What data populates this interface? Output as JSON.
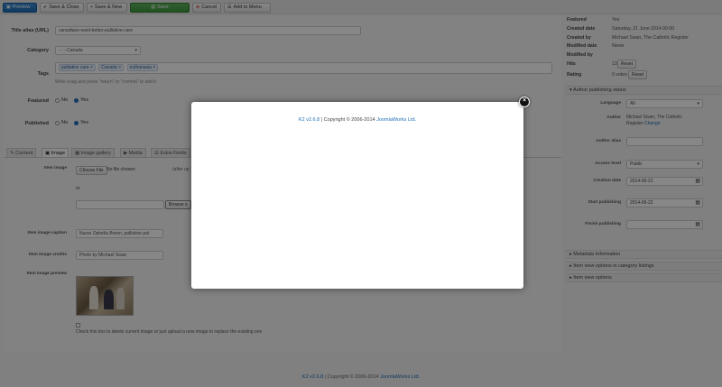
{
  "toolbar": {
    "preview": "Preview",
    "save_close": "Save & Close",
    "save_new": "Save & New",
    "save": "Save",
    "cancel": "Cancel",
    "add_menu": "Add to Menu"
  },
  "form": {
    "title_alias_label": "Title alias (URL)",
    "title_alias_value": "canadians-want-better-palliative-care",
    "category_label": "Category",
    "category_value": "- - - Canada",
    "tags_label": "Tags",
    "tags": [
      "palliative care",
      "Canada",
      "euthanasia"
    ],
    "tags_hint": "Write a tag and press \"return\" or \"comma\" to add it",
    "featured_label": "Featured",
    "published_label": "Published",
    "no": "No",
    "yes": "Yes"
  },
  "tabs": [
    "Content",
    "Image",
    "Image gallery",
    "Media",
    "Extra Fields"
  ],
  "image": {
    "item_image_label": "Item image",
    "choose_file": "Choose File",
    "no_file": "No file chosen",
    "after_upload": "(after up",
    "or": "or",
    "browse": "Browse s",
    "caption_label": "Item image caption",
    "caption_value": "Nurse Ophelia Breen, palliative pal",
    "credits_label": "Item image credits",
    "credits_value": "Photo by Michael Swan",
    "preview_label": "Item image preview",
    "delete_text": "Check this box to delete current image or just upload a new image to replace the existing one"
  },
  "sidebar": {
    "meta": [
      {
        "k": "Featured",
        "v": "Yes"
      },
      {
        "k": "Created date",
        "v": "Saturday, 21 June 2014 00:00"
      },
      {
        "k": "Created by",
        "v": "Michael Swan, The Catholic Register"
      },
      {
        "k": "Modified date",
        "v": "Never"
      },
      {
        "k": "Modified by",
        "v": ""
      },
      {
        "k": "Hits",
        "v": "13"
      },
      {
        "k": "Rating",
        "v": "0 votes"
      }
    ],
    "reset": "Reset",
    "author_publishing": "Author publishing status",
    "language_label": "Language",
    "language_value": "All",
    "author_label": "Author",
    "author_value": "Michael Swan, The Catholic Register",
    "change": "Change",
    "author_alias_label": "Author alias",
    "access_label": "Access level",
    "access_value": "Public",
    "creation_label": "Creation date",
    "creation_value": "2014-06-21",
    "start_label": "Start publishing",
    "start_value": "2014-06-22",
    "finish_label": "Finish publishing",
    "metadata": "Metadata Information",
    "view_category": "Item view options in category listings",
    "view_item": "Item view options"
  },
  "modal": {
    "version": "K2 v2.6.8",
    "copyright": "| Copyright © 2006-2014",
    "company": "JoomlaWorks Ltd."
  },
  "footer": {
    "version": "K2 v2.6.8",
    "copyright": "| Copyright © 2006-2014",
    "company": "JoomlaWorks Ltd."
  }
}
